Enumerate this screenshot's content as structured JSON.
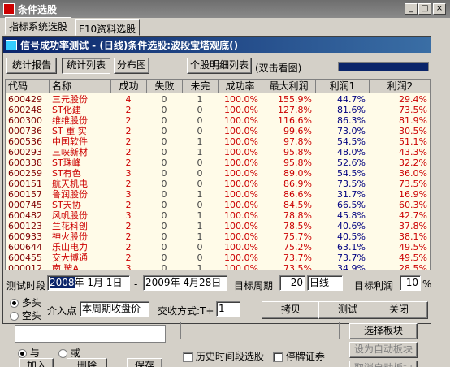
{
  "window": {
    "title": "条件选股",
    "min": "_",
    "max": "□",
    "close": "×"
  },
  "tabs": [
    {
      "label": "指标系统选股"
    },
    {
      "label": "F10资料选股"
    }
  ],
  "dialog": {
    "title": "信号成功率测试 - (日线)条件选股:波段宝塔观底()"
  },
  "toolbar": {
    "report": "统计报告",
    "list": "统计列表",
    "dist": "分布图",
    "detail": "个股明细列表",
    "hint": "(双击看图)"
  },
  "table": {
    "headers": [
      "代码",
      "名称",
      "成功",
      "失败",
      "未完",
      "成功率",
      "最大利润",
      "利润1",
      "利润2"
    ],
    "rows": [
      [
        "600429",
        "三元股份",
        "4",
        "0",
        "1",
        "100.0%",
        "155.9%",
        "44.7%",
        "29.4%"
      ],
      [
        "600248",
        "ST化建",
        "2",
        "0",
        "0",
        "100.0%",
        "127.8%",
        "81.6%",
        "73.5%"
      ],
      [
        "600300",
        "维维股份",
        "2",
        "0",
        "0",
        "100.0%",
        "116.6%",
        "86.3%",
        "81.9%"
      ],
      [
        "000736",
        "ST 重 实",
        "2",
        "0",
        "0",
        "100.0%",
        "99.6%",
        "73.0%",
        "30.5%"
      ],
      [
        "600536",
        "中国软件",
        "2",
        "0",
        "1",
        "100.0%",
        "97.8%",
        "54.5%",
        "51.1%"
      ],
      [
        "600293",
        "三峡新材",
        "2",
        "0",
        "1",
        "100.0%",
        "95.8%",
        "48.0%",
        "43.3%"
      ],
      [
        "600338",
        "ST珠峰",
        "2",
        "0",
        "0",
        "100.0%",
        "95.8%",
        "52.6%",
        "32.2%"
      ],
      [
        "600259",
        "ST有色",
        "3",
        "0",
        "0",
        "100.0%",
        "89.0%",
        "54.5%",
        "36.0%"
      ],
      [
        "600151",
        "航天机电",
        "2",
        "0",
        "0",
        "100.0%",
        "86.9%",
        "73.5%",
        "73.5%"
      ],
      [
        "600157",
        "鲁润股份",
        "3",
        "0",
        "1",
        "100.0%",
        "86.6%",
        "31.7%",
        "16.9%"
      ],
      [
        "000745",
        "ST天协",
        "2",
        "0",
        "0",
        "100.0%",
        "84.5%",
        "66.5%",
        "60.3%"
      ],
      [
        "600482",
        "风帆股份",
        "3",
        "0",
        "1",
        "100.0%",
        "78.8%",
        "45.8%",
        "42.7%"
      ],
      [
        "600123",
        "兰花科创",
        "2",
        "0",
        "1",
        "100.0%",
        "78.5%",
        "40.6%",
        "37.8%"
      ],
      [
        "600933",
        "神火股份",
        "2",
        "0",
        "1",
        "100.0%",
        "75.7%",
        "40.5%",
        "38.1%"
      ],
      [
        "600644",
        "乐山电力",
        "2",
        "0",
        "0",
        "100.0%",
        "75.2%",
        "63.1%",
        "49.5%"
      ],
      [
        "600455",
        "交大博通",
        "2",
        "0",
        "0",
        "100.0%",
        "73.7%",
        "73.7%",
        "49.5%"
      ],
      [
        "000012",
        "南  玻A",
        "3",
        "0",
        "1",
        "100.0%",
        "73.5%",
        "34.9%",
        "28.5%"
      ]
    ]
  },
  "form": {
    "period_label": "测试时段",
    "start_year": "2008",
    "start_rest": "年 1月 1日",
    "dash": "-",
    "end_date": "2009年 4月28日",
    "target_period_label": "目标周期",
    "target_period_value": "20",
    "period_unit": "日线",
    "target_profit_label": "目标利润",
    "target_profit_value": "10",
    "percent": "%",
    "long_label": "多头",
    "short_label": "空头",
    "entry_label": "介入点",
    "entry_value": "本周期收盘价",
    "trade_label": "交收方式:T+",
    "trade_value": "1",
    "copy": "拷贝",
    "test": "测试",
    "close": "关闭"
  },
  "bottom": {
    "and": "与",
    "or": "或",
    "add": "加入",
    "delete": "删除",
    "save": "保存",
    "history": "历史时间段选股",
    "suspended": "停牌证券",
    "select_block": "选择板块",
    "set_auto": "设为自动板块",
    "cancel_auto": "取消自动板块"
  }
}
